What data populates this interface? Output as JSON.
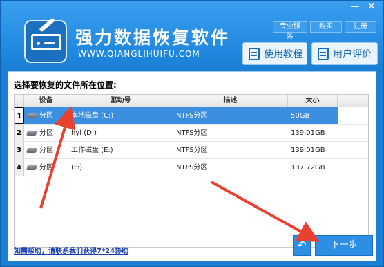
{
  "window": {
    "minimize_glyph": "—",
    "close_glyph": "✕"
  },
  "header": {
    "title": "强力数据恢复软件",
    "url": "WWW.QIANGLIHUIFU.COM",
    "links": [
      "专业服务",
      "购买",
      "注册"
    ],
    "tutorial_label": "使用教程",
    "review_label": "用户评价"
  },
  "panel": {
    "label": "选择要恢复的文件所在位置:",
    "columns": [
      "设备",
      "驱动号",
      "描述",
      "大小"
    ],
    "rows": [
      {
        "num": "1",
        "device": "分区",
        "drive": "本地磁盘 (C:)",
        "desc": "NTFS分区",
        "size": "50GB"
      },
      {
        "num": "2",
        "device": "分区",
        "drive": "hyl (D:)",
        "desc": "NTFS分区",
        "size": "139.01GB"
      },
      {
        "num": "3",
        "device": "分区",
        "drive": "工作磁盘 (E:)",
        "desc": "NTFS分区",
        "size": "139.01GB"
      },
      {
        "num": "4",
        "device": "分区",
        "drive": "(F:)",
        "desc": "NTFS分区",
        "size": "137.72GB"
      }
    ],
    "help_link": "如需帮助，请联系我们获得7*24协助"
  },
  "footer": {
    "back_glyph": "↶",
    "next_label": "下一步"
  },
  "colors": {
    "accent": "#1e86dd",
    "selected_row": "#3c8ee0",
    "annotation_arrow": "#e8412f"
  }
}
